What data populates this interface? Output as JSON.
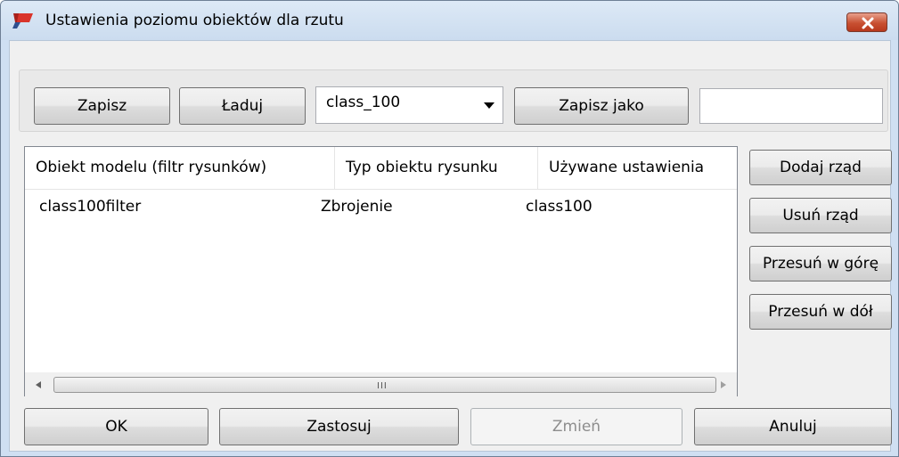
{
  "window": {
    "title": "Ustawienia poziomu obiektów dla rzutu",
    "accent": "#d9342b"
  },
  "toolbar": {
    "save_label": "Zapisz",
    "load_label": "Ładuj",
    "preset_value": "class_100",
    "save_as_label": "Zapisz jako",
    "save_as_name": ""
  },
  "table": {
    "columns": [
      "Obiekt modelu (filtr rysunków)",
      "Typ obiektu rysunku",
      "Używane ustawienia"
    ],
    "rows": [
      [
        "class100filter",
        "Zbrojenie",
        "class100"
      ]
    ],
    "scroll_grip": "III"
  },
  "side_buttons": {
    "add_row": "Dodaj rząd",
    "remove_row": "Usuń rząd",
    "move_up": "Przesuń w górę",
    "move_down": "Przesuń w dół"
  },
  "footer": {
    "ok": "OK",
    "apply": "Zastosuj",
    "modify": "Zmień",
    "cancel": "Anuluj"
  },
  "icons": {
    "app": "app-icon",
    "close": "close-icon",
    "dropdown": "chevron-down-icon",
    "scroll_left": "arrow-left-icon",
    "scroll_right": "arrow-right-icon"
  }
}
